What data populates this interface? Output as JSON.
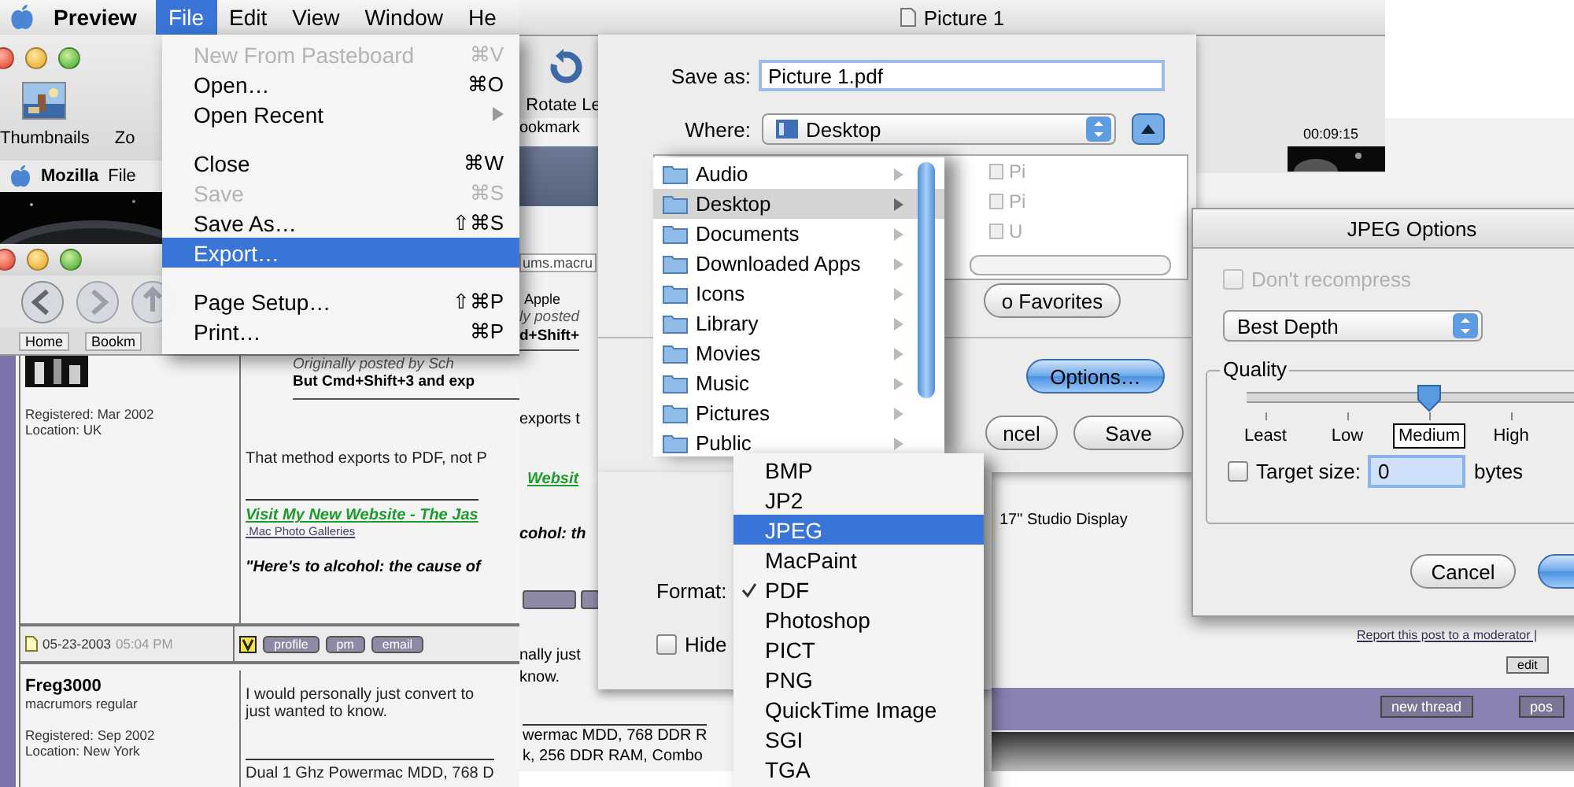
{
  "menu_bar": {
    "app": "Preview",
    "menus": [
      {
        "label": "File",
        "selected": true
      },
      {
        "label": "Edit",
        "selected": false
      },
      {
        "label": "View",
        "selected": false
      },
      {
        "label": "Window",
        "selected": false
      },
      {
        "label": "He",
        "selected": false
      }
    ]
  },
  "file_menu": [
    {
      "kind": "item",
      "label": "New From Pasteboard",
      "shortcut": "⌘V",
      "disabled": true,
      "selected": false
    },
    {
      "kind": "item",
      "label": "Open…",
      "shortcut": "⌘O",
      "disabled": false,
      "selected": false
    },
    {
      "kind": "submenu",
      "label": "Open Recent",
      "disabled": false,
      "selected": false
    },
    {
      "kind": "separator"
    },
    {
      "kind": "item",
      "label": "Close",
      "shortcut": "⌘W",
      "disabled": false,
      "selected": false
    },
    {
      "kind": "item",
      "label": "Save",
      "shortcut": "⌘S",
      "disabled": true,
      "selected": false
    },
    {
      "kind": "item",
      "label": "Save As…",
      "shortcut": "⇧⌘S",
      "disabled": false,
      "selected": false
    },
    {
      "kind": "item",
      "label": "Export…",
      "disabled": false,
      "selected": true
    },
    {
      "kind": "separator"
    },
    {
      "kind": "item",
      "label": "Page Setup…",
      "shortcut": "⇧⌘P",
      "disabled": false,
      "selected": false
    },
    {
      "kind": "item",
      "label": "Print…",
      "shortcut": "⌘P",
      "disabled": false,
      "selected": false
    }
  ],
  "preview_window": {
    "toolbar": [
      "Thumbnails",
      "Zo"
    ]
  },
  "picture_window": {
    "title": "Picture 1",
    "toolbar": [
      "Rotate Le"
    ],
    "time": "00:09:15"
  },
  "mozilla": {
    "app": "Mozilla",
    "menus": [
      "File"
    ],
    "bookmarks": [
      "Home",
      "Bookm"
    ],
    "post_1": {
      "registered": "Registered: Mar 2002",
      "location": "Location: UK",
      "quote_by": "Originally posted by Sch",
      "quote": "But Cmd+Shift+3 and exp",
      "body": "That method exports to PDF, not P",
      "sig_link": "Visit My New Website - The Jas",
      "sig_sub": ".Mac Photo Galleries",
      "sig_quote": "\"Here's to alcohol: the cause of",
      "date": "05-23-2003",
      "time": "05:04 PM",
      "buttons": [
        "profile",
        "pm",
        "email"
      ]
    },
    "post_2": {
      "author": "Freg3000",
      "rank": "macrumors regular",
      "registered": "Registered: Sep 2002",
      "location": "Location: New York",
      "body": [
        "I would personally just convert to",
        "just wanted to know."
      ],
      "sig": "Dual 1 Ghz Powermac MDD, 768 D"
    }
  },
  "forum_window": {
    "bookmark": "ookmark",
    "url": "ums.macru",
    "bookmark_link": "Apple",
    "quote_by": "ly posted",
    "quote": "d+Shift+",
    "body": "exports t",
    "link": "Websit",
    "sig_quote": "cohol: th",
    "reply_lines": [
      "nally just",
      "know."
    ],
    "sig_lines": [
      "wermac MDD, 768 DDR R",
      "k, 256 DDR RAM, Combo"
    ],
    "display": "17\" Studio Display",
    "report_link": "Report this post to a moderator |",
    "edit_button": "edit",
    "thread_buttons": [
      "new thread",
      "pos"
    ]
  },
  "save_sheet": {
    "save_as_label": "Save as:",
    "file_name": "Picture 1.pdf",
    "where_label": "Where:",
    "where": "Desktop",
    "folders": [
      {
        "label": "Audio",
        "selected": false
      },
      {
        "label": "Desktop",
        "selected": true
      },
      {
        "label": "Documents",
        "selected": false
      },
      {
        "label": "Downloaded Apps",
        "selected": false
      },
      {
        "label": "Icons",
        "selected": false
      },
      {
        "label": "Library",
        "selected": false
      },
      {
        "label": "Movies",
        "selected": false
      },
      {
        "label": "Music",
        "selected": false
      },
      {
        "label": "Pictures",
        "selected": false
      },
      {
        "label": "Public",
        "selected": false
      }
    ],
    "files": [
      "Pi",
      "Pi",
      "U"
    ],
    "favorites_button": "o Favorites",
    "options_button": "Options…",
    "cancel_button": "ncel",
    "save_button": "Save",
    "format_label": "Format:",
    "hide_extension": {
      "label": "Hide",
      "checked": false
    }
  },
  "format_menu": [
    {
      "label": "BMP",
      "selected": false,
      "checked": false
    },
    {
      "label": "JP2",
      "selected": false,
      "checked": false
    },
    {
      "label": "JPEG",
      "selected": true,
      "checked": false
    },
    {
      "label": "MacPaint",
      "selected": false,
      "checked": false
    },
    {
      "label": "PDF",
      "selected": false,
      "checked": true
    },
    {
      "label": "Photoshop",
      "selected": false,
      "checked": false
    },
    {
      "label": "PICT",
      "selected": false,
      "checked": false
    },
    {
      "label": "PNG",
      "selected": false,
      "checked": false
    },
    {
      "label": "QuickTime Image",
      "selected": false,
      "checked": false
    },
    {
      "label": "SGI",
      "selected": false,
      "checked": false
    },
    {
      "label": "TGA",
      "selected": false,
      "checked": false
    }
  ],
  "jpeg_options": {
    "title": "JPEG Options",
    "dont_recompress": {
      "label": "Don't recompress",
      "checked": false,
      "disabled": true
    },
    "depth": "Best Depth",
    "quality": {
      "label": "Quality",
      "level": 0.5,
      "ticks": [
        {
          "label": "Least",
          "selected": false
        },
        {
          "label": "Low",
          "selected": false
        },
        {
          "label": "Medium",
          "selected": true
        },
        {
          "label": "High",
          "selected": false
        }
      ]
    },
    "target_size": {
      "label": "Target size:",
      "checked": false,
      "value": "0",
      "unit": "bytes"
    },
    "cancel_button": "Cancel"
  }
}
